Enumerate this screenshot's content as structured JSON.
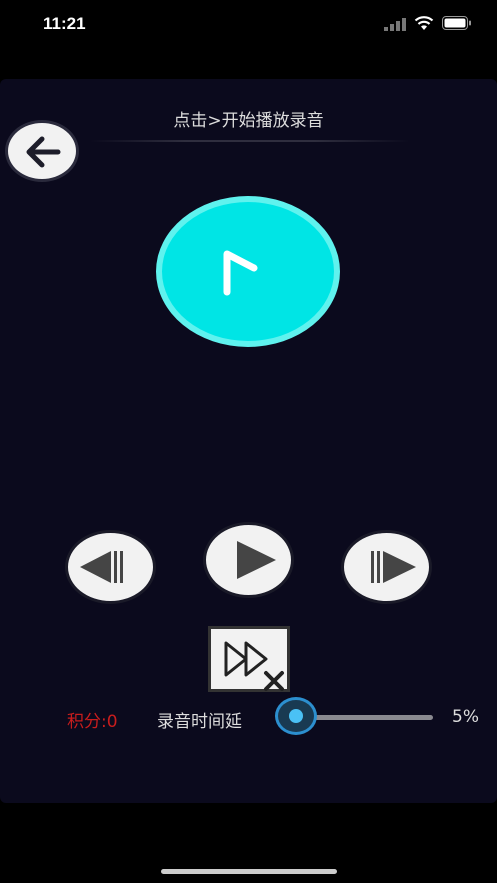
{
  "status_bar": {
    "time": "11:21"
  },
  "header": {
    "hint": "点击>开始播放录音"
  },
  "icons": {
    "back": "arrow-left-icon",
    "timer": "clock-hand-icon",
    "prev": "skip-previous-icon",
    "play": "play-icon",
    "next": "skip-next-icon",
    "speed": "fast-forward-cancel-icon"
  },
  "footer": {
    "score": "积分:0",
    "slider_label": "录音时间延",
    "slider_value": 0.05,
    "percent": "5%"
  },
  "colors": {
    "accent": "#00e5e5",
    "score": "#c81d1d",
    "panel": "#0b0a1d",
    "slider_thumb": "#4ac1f5"
  }
}
